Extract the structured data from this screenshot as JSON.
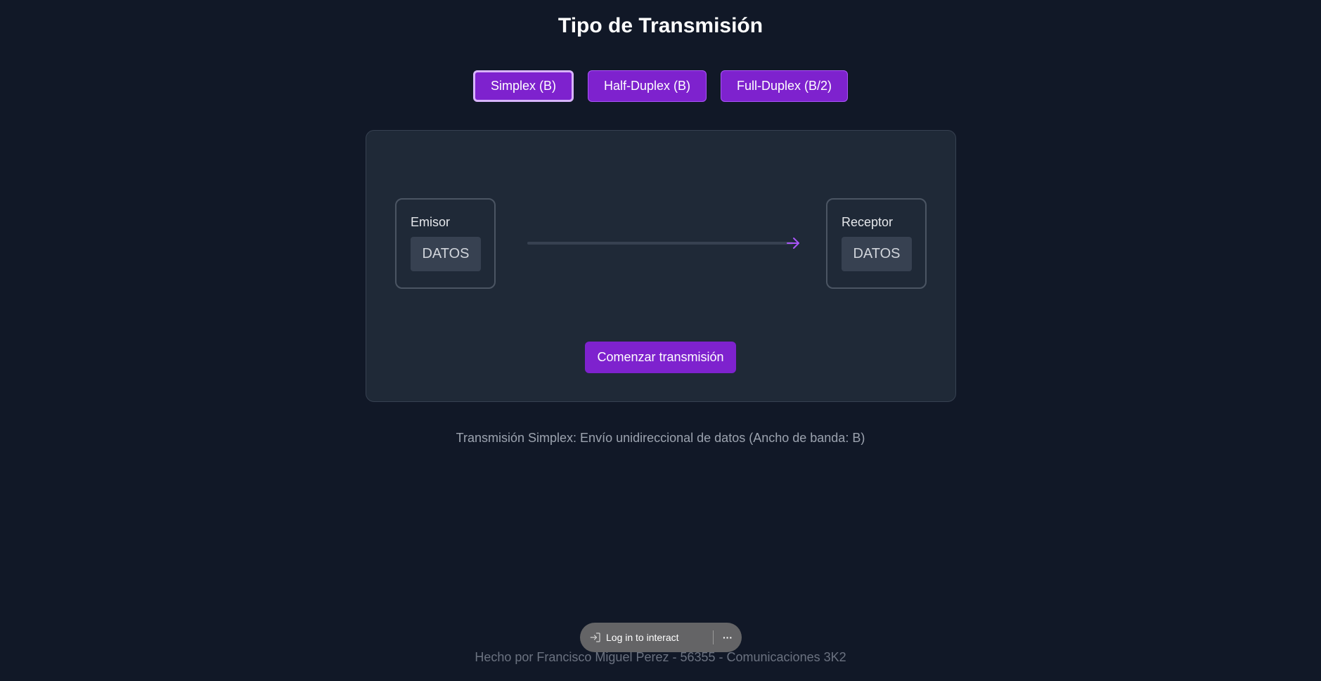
{
  "page": {
    "title": "Tipo de Transmisión"
  },
  "modes": [
    {
      "label": "Simplex (B)",
      "active": true
    },
    {
      "label": "Half-Duplex (B)",
      "active": false
    },
    {
      "label": "Full-Duplex (B/2)",
      "active": false
    }
  ],
  "diagram": {
    "sender_label": "Emisor",
    "sender_data": "DATOS",
    "receiver_label": "Receptor",
    "receiver_data": "DATOS",
    "direction_icon": "arrow-right-icon"
  },
  "actions": {
    "start_label": "Comenzar transmisión"
  },
  "description": "Transmisión Simplex: Envío unidireccional de datos (Ancho de banda: B)",
  "footer": "Hecho por Francisco Miguel Perez - 56355 - Comunicaciones 3K2",
  "overlay": {
    "login_label": "Log in to interact",
    "login_icon": "sign-in-icon",
    "more_icon": "more-horizontal-icon"
  },
  "colors": {
    "background": "#111827",
    "panel": "#1f2937",
    "accent": "#7e22ce",
    "accent_light": "#a855f7"
  }
}
